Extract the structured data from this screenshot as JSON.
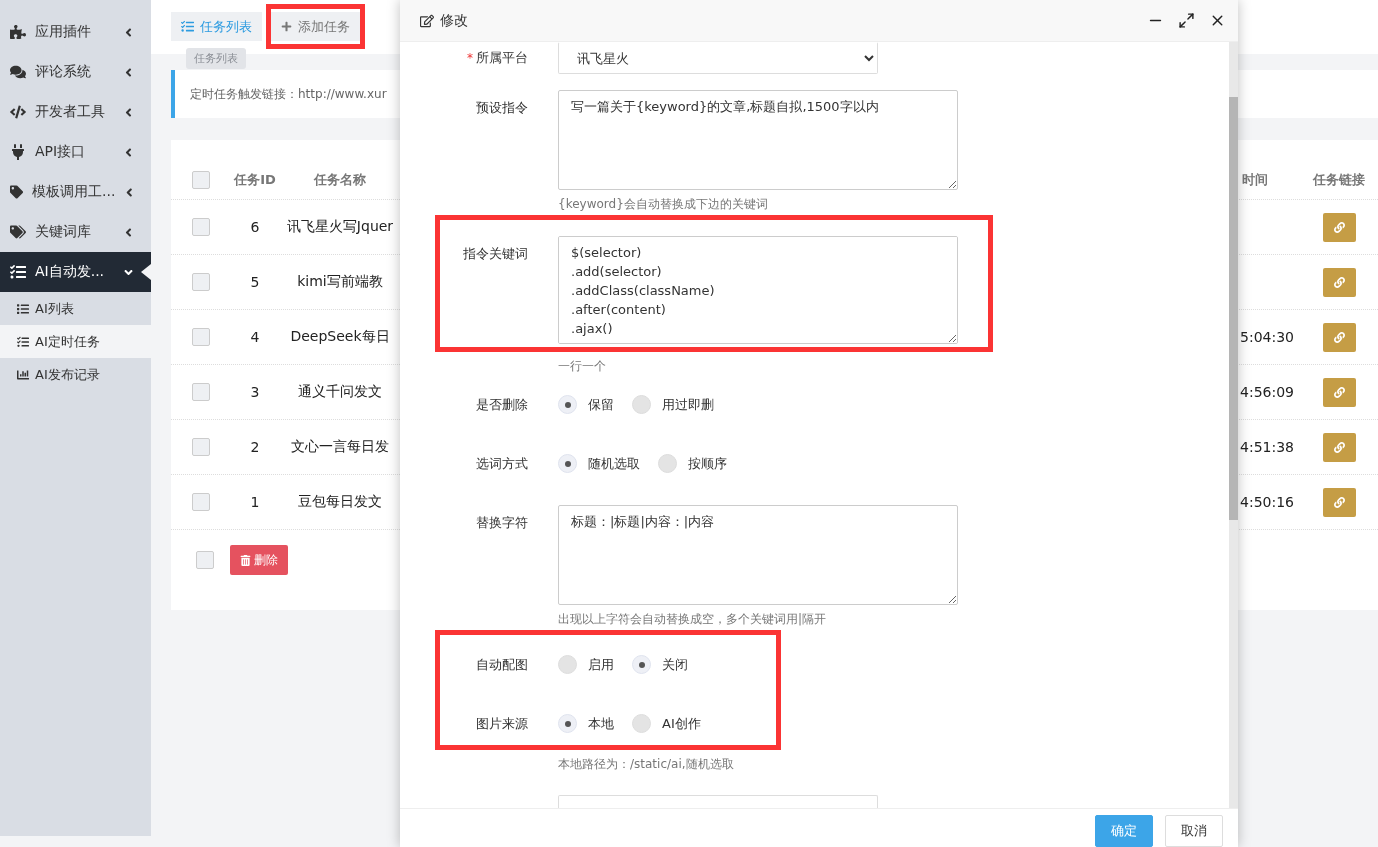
{
  "sidebar": {
    "items": [
      {
        "label": "应用插件",
        "expanded": false,
        "selected": false
      },
      {
        "label": "评论系统",
        "expanded": false,
        "selected": false
      },
      {
        "label": "开发者工具",
        "expanded": false,
        "selected": false
      },
      {
        "label": "API接口",
        "expanded": false,
        "selected": false
      },
      {
        "label": "模板调用工...",
        "expanded": false,
        "selected": false
      },
      {
        "label": "关键词库",
        "expanded": false,
        "selected": false
      },
      {
        "label": "AI自动发...",
        "expanded": true,
        "selected": true,
        "children": [
          {
            "label": "AI列表",
            "selected": false
          },
          {
            "label": "AI定时任务",
            "selected": true
          },
          {
            "label": "AI发布记录",
            "selected": false
          }
        ]
      }
    ]
  },
  "tabs": [
    {
      "label": "任务列表",
      "selected": true,
      "highlighted": false
    },
    {
      "label": "添加任务",
      "selected": false,
      "highlighted": true
    }
  ],
  "tooltip": "任务列表",
  "notice": "定时任务触发链接：http://www.xur",
  "table": {
    "header_checked": false,
    "columns": [
      "任务ID",
      "任务名称",
      "时间",
      "任务链接"
    ],
    "rows": [
      {
        "checked": false,
        "id": "6",
        "name": "讯飞星火写Jquer"
      },
      {
        "checked": false,
        "id": "5",
        "name": "kimi写前端教"
      },
      {
        "checked": false,
        "id": "4",
        "name": "DeepSeek每日",
        "time": "5:04:30"
      },
      {
        "checked": false,
        "id": "3",
        "name": "通义千问发文",
        "time": "4:56:09"
      },
      {
        "checked": false,
        "id": "2",
        "name": "文心一言每日发",
        "time": "4:51:38"
      },
      {
        "checked": false,
        "id": "1",
        "name": "豆包每日发文",
        "time": "4:50:16"
      }
    ],
    "bulk_checked": false,
    "delete_button": "删除"
  },
  "modal": {
    "title": "修改",
    "rows": [
      {
        "kind": "select",
        "label": "所属平台",
        "required_mark": "*",
        "value": "讯飞星火",
        "highlighted": false
      },
      {
        "kind": "textarea",
        "label": "预设指令",
        "value": "写一篇关于{keyword}的文章,标题自拟,1500字以内",
        "hint": "{keyword}会自动替换成下边的关键词",
        "highlighted": false
      },
      {
        "kind": "textarea",
        "label": "指令关键词",
        "lines": [
          "$(selector)",
          ".add(selector)",
          ".addClass(className)",
          ".after(content)",
          ".ajax()"
        ],
        "hint": "一行一个",
        "highlighted": true
      },
      {
        "kind": "radio",
        "label": "是否删除",
        "options": [
          {
            "label": "保留",
            "selected": true
          },
          {
            "label": "用过即删",
            "selected": false
          }
        ],
        "highlighted": false
      },
      {
        "kind": "radio",
        "label": "选词方式",
        "options": [
          {
            "label": "随机选取",
            "selected": true
          },
          {
            "label": "按顺序",
            "selected": false
          }
        ],
        "highlighted": false
      },
      {
        "kind": "textarea",
        "label": "替换字符",
        "value": "标题：|标题|内容：|内容",
        "hint": "出现以上字符会自动替换成空，多个关键词用|隔开",
        "highlighted": false
      },
      {
        "kind": "radio",
        "label": "自动配图",
        "options": [
          {
            "label": "启用",
            "selected": false
          },
          {
            "label": "关闭",
            "selected": true
          }
        ],
        "highlighted": true
      },
      {
        "kind": "radio",
        "label": "图片来源",
        "options": [
          {
            "label": "本地",
            "selected": true
          },
          {
            "label": "AI创作",
            "selected": false
          }
        ],
        "hint": "本地路径为：/static/ai,随机选取",
        "highlighted": true
      },
      {
        "kind": "input",
        "highlighted": false
      }
    ],
    "buttons": [
      {
        "label": "确定",
        "kind": "primary"
      },
      {
        "label": "取消",
        "kind": "secondary"
      }
    ]
  }
}
